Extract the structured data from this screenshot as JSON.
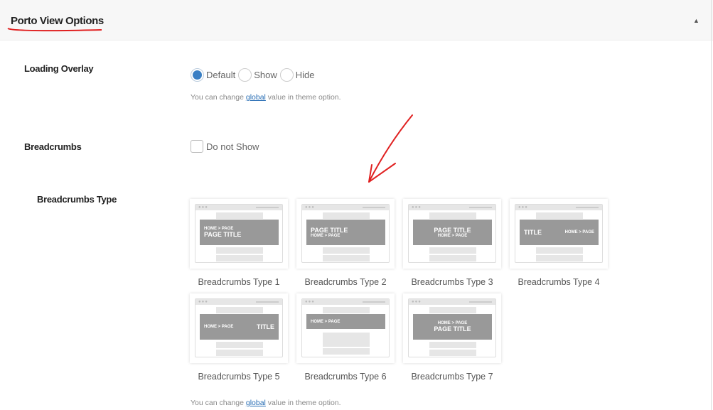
{
  "header": {
    "title": "Porto View Options",
    "toggle": "▲"
  },
  "loading_overlay": {
    "label": "Loading Overlay",
    "options": [
      "Default",
      "Show",
      "Hide"
    ],
    "selected": "Default",
    "hint_pre": "You can change ",
    "hint_link": "global",
    "hint_post": " value in theme option."
  },
  "breadcrumbs": {
    "label": "Breadcrumbs",
    "checkbox_label": "Do not Show",
    "checked": false
  },
  "breadcrumbs_type": {
    "label": "Breadcrumbs Type",
    "hint_pre": "You can change ",
    "hint_link": "global",
    "hint_post": " value in theme option.",
    "types": [
      {
        "caption": "Breadcrumbs Type 1",
        "variant": "left-bc-top",
        "crumb": "HOME > PAGE",
        "title": "PAGE TITLE"
      },
      {
        "caption": "Breadcrumbs Type 2",
        "variant": "left-title-top",
        "crumb": "HOME > PAGE",
        "title": "PAGE TITLE"
      },
      {
        "caption": "Breadcrumbs Type 3",
        "variant": "center-title-top",
        "crumb": "HOME > PAGE",
        "title": "PAGE TITLE"
      },
      {
        "caption": "Breadcrumbs Type 4",
        "variant": "title-left",
        "crumb": "HOME > PAGE",
        "title": "TITLE"
      },
      {
        "caption": "Breadcrumbs Type 5",
        "variant": "title-right",
        "crumb": "HOME > PAGE",
        "title": "TITLE"
      },
      {
        "caption": "Breadcrumbs Type 6",
        "variant": "bc-only",
        "crumb": "HOME > PAGE",
        "title": ""
      },
      {
        "caption": "Breadcrumbs Type 7",
        "variant": "center-bc-top",
        "crumb": "HOME > PAGE",
        "title": "PAGE TITLE"
      }
    ]
  },
  "colors": {
    "accent": "#3a7fc4",
    "annotation": "#e02020",
    "banner": "#999999"
  }
}
